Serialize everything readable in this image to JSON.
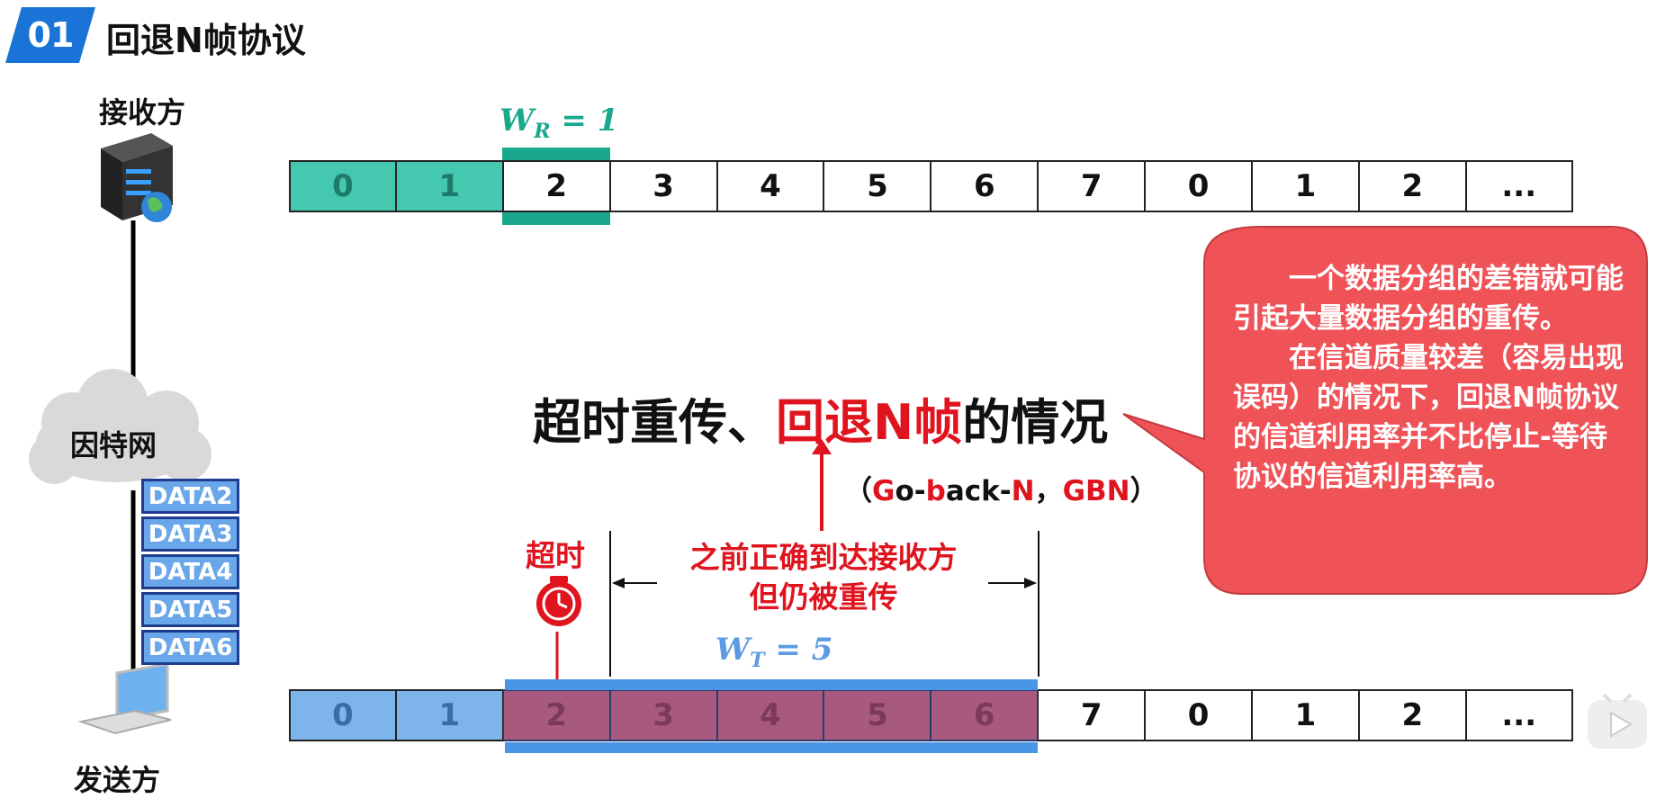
{
  "header": {
    "number": "01",
    "title": "回退N帧协议"
  },
  "receiver": {
    "label": "接收方"
  },
  "sender": {
    "label": "发送方"
  },
  "internet": {
    "label": "因特网"
  },
  "receiver_strip": {
    "cells": [
      "0",
      "1",
      "2",
      "3",
      "4",
      "5",
      "6",
      "7",
      "0",
      "1",
      "2",
      "..."
    ],
    "acked_count": 2
  },
  "sender_strip": {
    "cells": [
      "0",
      "1",
      "2",
      "3",
      "4",
      "5",
      "6",
      "7",
      "0",
      "1",
      "2",
      "..."
    ],
    "acked_count": 2,
    "window_count": 5
  },
  "receive_window": {
    "label": "W_R = 1",
    "main": "W",
    "sub": "R",
    "rest": " = 1"
  },
  "send_window": {
    "label": "W_T = 5",
    "main": "W",
    "sub": "T",
    "rest": " = 5"
  },
  "data_stack": [
    "DATA2",
    "DATA3",
    "DATA4",
    "DATA5",
    "DATA6"
  ],
  "timeout": {
    "label": "超时"
  },
  "note": {
    "line1": "之前正确到达接收方",
    "line2": "但仍被重传"
  },
  "big_title": {
    "part1": "超时重传、",
    "part2": "回退N帧",
    "part3": "的情况"
  },
  "gbn": {
    "open": "（",
    "g1": "G",
    "t1": "o-",
    "g2": "b",
    "t2": "ack-",
    "g3": "N",
    "t3": "，",
    "g4": "GBN",
    "close": "）"
  },
  "callout": {
    "para1": "一个数据分组的差错就可能引起大量数据分组的重传。",
    "para2": "在信道质量较差（容易出现误码）的情况下，回退N帧协议的信道利用率并不比停止-等待协议的信道利用率高。"
  },
  "colors": {
    "badge": "#1a73d6",
    "callout": "#ef5358",
    "receive_ack": "#45c8b0",
    "send_ack": "#7db4ea",
    "accent_red": "#e0141e"
  }
}
